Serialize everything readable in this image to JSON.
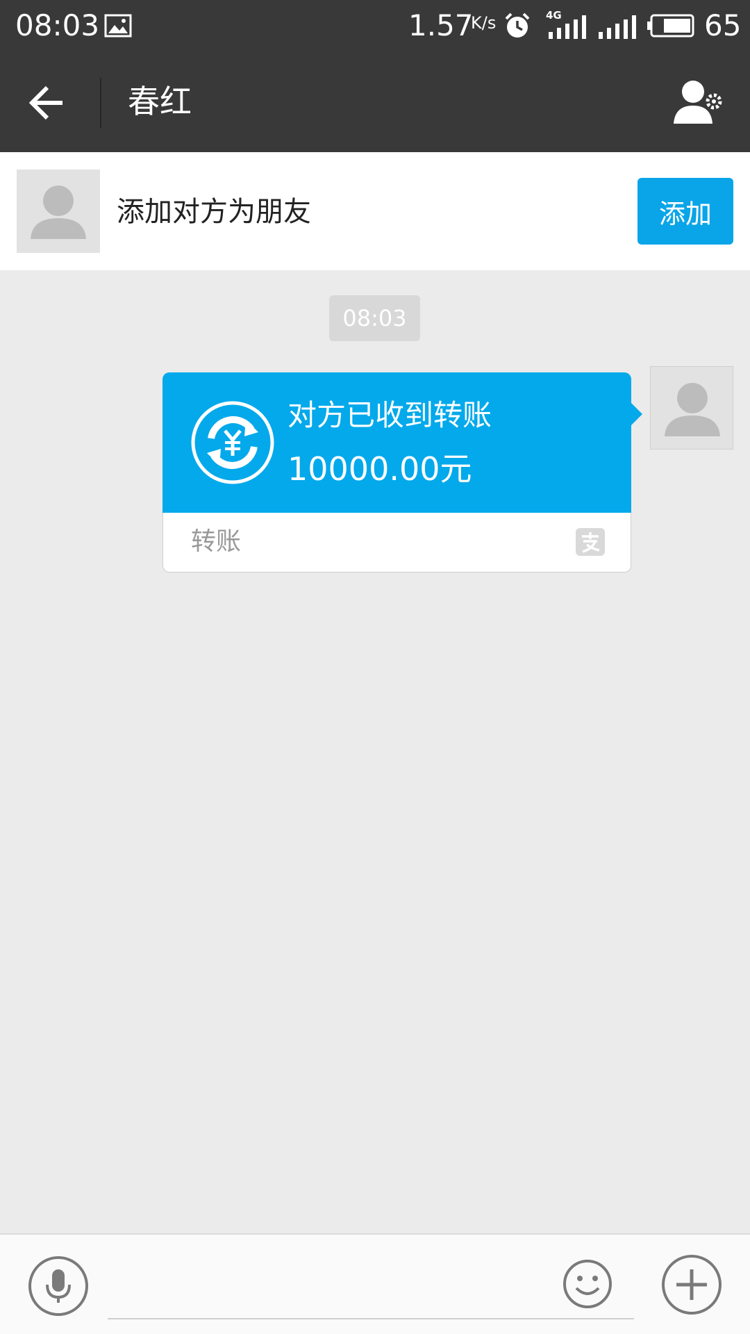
{
  "status_bar": {
    "time": "08:03",
    "speed": "1.57",
    "speed_unit": "K/s",
    "network": "4G",
    "battery": "65"
  },
  "header": {
    "title": "春红"
  },
  "friend_banner": {
    "text": "添加对方为朋友",
    "add_label": "添加"
  },
  "chat": {
    "timestamp": "08:03",
    "transfer": {
      "status": "对方已收到转账",
      "amount": "10000.00元",
      "label": "转账"
    }
  },
  "input_bar": {
    "message_value": ""
  },
  "colors": {
    "bar_bg": "#393939",
    "accent": "#0aa5e8",
    "card_blue": "#03a9eb",
    "chat_bg": "#ebebeb"
  },
  "icons": [
    "back-arrow-icon",
    "profile-settings-icon",
    "avatar-icon",
    "transfer-yuan-icon",
    "alipay-icon",
    "microphone-icon",
    "emoji-icon",
    "plus-icon"
  ]
}
